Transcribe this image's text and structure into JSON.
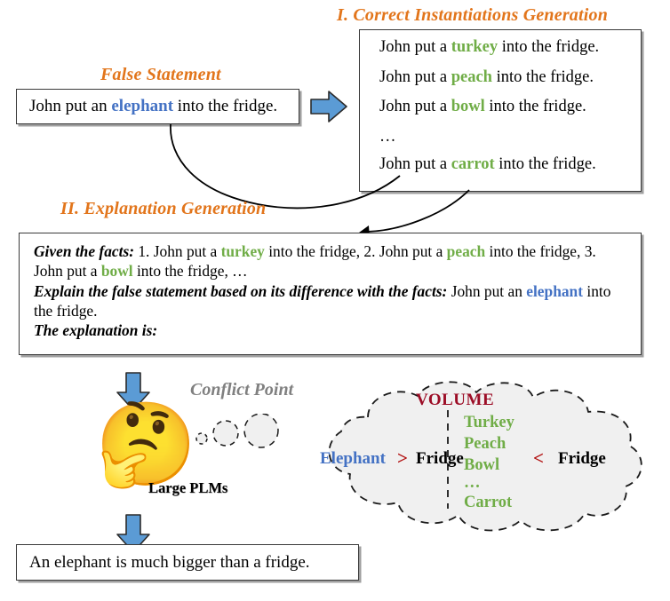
{
  "figure": {
    "sections": {
      "step1_title": "I. Correct Instantiations Generation",
      "step2_title": "II. Explanation Generation",
      "false_statement_title": "False Statement"
    },
    "false_statement": {
      "prefix": "John put an ",
      "keyword": "elephant",
      "suffix": " into the fridge."
    },
    "instantiations": [
      {
        "prefix": "John put a ",
        "keyword": "turkey",
        "suffix": " into the fridge."
      },
      {
        "prefix": "John put a ",
        "keyword": "peach",
        "suffix": " into the fridge."
      },
      {
        "prefix": "John put a ",
        "keyword": "bowl",
        "suffix": " into the fridge."
      },
      {
        "prefix": "",
        "keyword": "",
        "suffix": "…"
      },
      {
        "prefix": "John put a ",
        "keyword": "carrot",
        "suffix": " into the fridge."
      }
    ],
    "explanation_prompt": {
      "facts_lead": "Given the facts:",
      "facts_part1": " 1. John put a ",
      "facts_kw1": "turkey",
      "facts_part2": " into the fridge, 2. John put a ",
      "facts_kw2": "peach",
      "facts_part3": " into the fridge, 3. John put a ",
      "facts_kw3": "bowl",
      "facts_part4": " into the fridge, …",
      "explain_lead": "Explain the false statement based on its difference with the facts:",
      "explain_part1": " John put an ",
      "explain_kw": "elephant",
      "explain_part2": " into the fridge.",
      "answer_lead": "The explanation is:"
    },
    "model": {
      "label": "Large PLMs",
      "face_icon": "thinking-face-emoji"
    },
    "conflict": {
      "label": "Conflict Point",
      "volume_title": "VOLUME",
      "left_compare": {
        "subject": "Elephant",
        "operator": ">",
        "object": "Fridge"
      },
      "right_compare": {
        "items": [
          "Turkey",
          "Peach",
          "Bowl",
          "…",
          "Carrot"
        ],
        "operator": "<",
        "object": "Fridge"
      }
    },
    "output": {
      "text": "An elephant is much bigger than a fridge."
    },
    "colors": {
      "heading_orange": "#E2751B",
      "keyword_blue": "#4472C4",
      "keyword_green": "#70AD47",
      "volume_red": "#9C0D26",
      "operator_red": "#B21010",
      "conflict_gray": "#808080",
      "arrow_blue": "#5B9BD5",
      "cloud_fill": "#F0F0F0"
    }
  }
}
